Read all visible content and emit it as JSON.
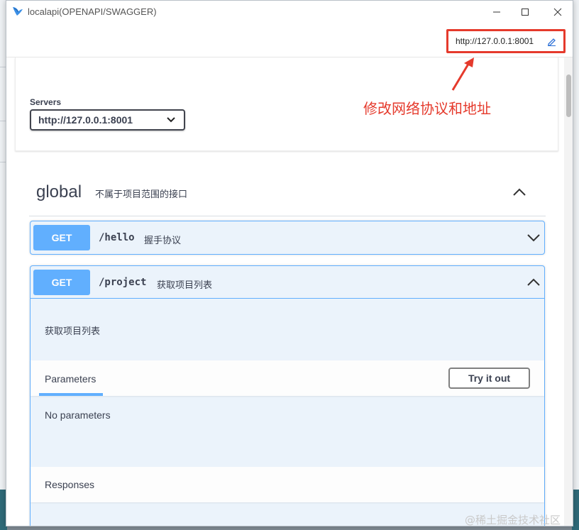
{
  "window": {
    "title": "localapi(OPENAPI/SWAGGER)",
    "min_icon": "minimize-icon",
    "max_icon": "maximize-icon",
    "close_icon": "close-icon"
  },
  "toolbar": {
    "url": "http://127.0.0.1:8001",
    "edit_icon": "pencil-icon"
  },
  "annotation": {
    "text": "修改网络协议和地址",
    "color": "#e53a2c"
  },
  "servers": {
    "label": "Servers",
    "selected": "http://127.0.0.1:8001"
  },
  "tag": {
    "name": "global",
    "description": "不属于项目范围的接口"
  },
  "operations": [
    {
      "method": "GET",
      "path": "/hello",
      "summary": "握手协议",
      "expanded": false
    },
    {
      "method": "GET",
      "path": "/project",
      "summary": "获取项目列表",
      "expanded": true,
      "description": "获取项目列表",
      "parameters_title": "Parameters",
      "try_button": "Try it out",
      "no_parameters": "No parameters",
      "responses_title": "Responses"
    }
  ],
  "watermark": "@稀土掘金技术社区",
  "colors": {
    "get_method": "#61affe",
    "get_bg": "#ebf3fb",
    "highlight": "#e53a2c"
  }
}
